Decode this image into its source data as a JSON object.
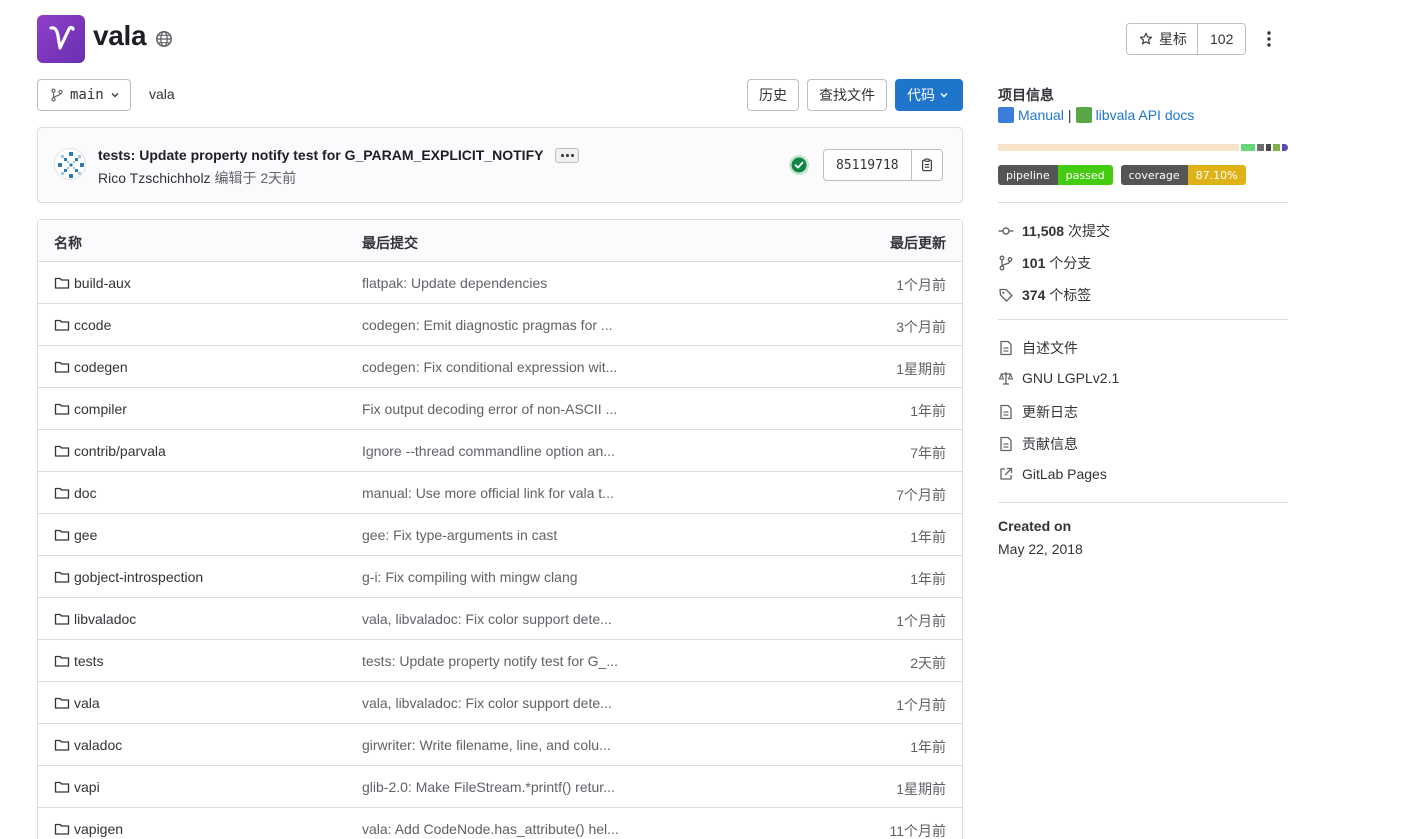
{
  "project": {
    "name": "vala",
    "avatar_letter": "V",
    "avatar_color": "#7b35bd"
  },
  "star": {
    "label": "星标",
    "count": "102"
  },
  "toolbar": {
    "branch": "main",
    "breadcrumb": "vala",
    "history": "历史",
    "find_file": "查找文件",
    "code": "代码",
    "code_color": "#1f75cb"
  },
  "commit": {
    "title": "tests: Update property notify test for G_PARAM_EXPLICIT_NOTIFY",
    "author": "Rico Tzschichholz",
    "meta": "编辑于 2天前",
    "sha": "85119718",
    "status_color": "#108548"
  },
  "table": {
    "headers": {
      "name": "名称",
      "last_commit": "最后提交",
      "last_update": "最后更新"
    },
    "rows": [
      {
        "name": "build-aux",
        "message": "flatpak: Update dependencies",
        "time": "1个月前"
      },
      {
        "name": "ccode",
        "message": "codegen: Emit diagnostic pragmas for ...",
        "time": "3个月前"
      },
      {
        "name": "codegen",
        "message": "codegen: Fix conditional expression wit...",
        "time": "1星期前"
      },
      {
        "name": "compiler",
        "message": "Fix output decoding error of non-ASCII ...",
        "time": "1年前"
      },
      {
        "name": "contrib/parvala",
        "message": "Ignore --thread commandline option an...",
        "time": "7年前"
      },
      {
        "name": "doc",
        "message": "manual: Use more official link for vala t...",
        "time": "7个月前"
      },
      {
        "name": "gee",
        "message": "gee: Fix type-arguments in cast",
        "time": "1年前"
      },
      {
        "name": "gobject-introspection",
        "message": "g-i: Fix compiling with mingw clang",
        "time": "1年前"
      },
      {
        "name": "libvaladoc",
        "message": "vala, libvaladoc: Fix color support dete...",
        "time": "1个月前"
      },
      {
        "name": "tests",
        "message": "tests: Update property notify test for G_...",
        "time": "2天前"
      },
      {
        "name": "vala",
        "message": "vala, libvaladoc: Fix color support dete...",
        "time": "1个月前"
      },
      {
        "name": "valadoc",
        "message": "girwriter: Write filename, line, and colu...",
        "time": "1年前"
      },
      {
        "name": "vapi",
        "message": "glib-2.0: Make FileStream.*printf() retur...",
        "time": "1星期前"
      },
      {
        "name": "vapigen",
        "message": "vala: Add CodeNode.has_attribute() hel...",
        "time": "11个月前"
      }
    ]
  },
  "sidebar": {
    "heading": "项目信息",
    "links": [
      {
        "label": "Manual",
        "icon": "blue-book-icon"
      },
      {
        "label": "libvala API docs",
        "icon": "green-book-icon"
      }
    ],
    "link_separator": "|",
    "language_colors": [
      "#f6e3c9",
      "#66d67a",
      "#6e6e6e",
      "#4a4a4a",
      "#7fb24a",
      "#5b4aa8"
    ],
    "badges": [
      {
        "left": "pipeline",
        "right": "passed",
        "right_color": "#4c1"
      },
      {
        "left": "coverage",
        "right": "87.10%",
        "right_color": "#dfb317"
      }
    ],
    "stats": [
      {
        "value": "11,508",
        "label": "次提交",
        "icon": "commit-icon"
      },
      {
        "value": "101",
        "label": "个分支",
        "icon": "branch-icon"
      },
      {
        "value": "374",
        "label": "个标签",
        "icon": "tag-icon"
      }
    ],
    "files": [
      {
        "label": "自述文件",
        "icon": "document-icon"
      },
      {
        "label": "GNU LGPLv2.1",
        "icon": "scale-icon"
      },
      {
        "label": "更新日志",
        "icon": "document-icon"
      },
      {
        "label": "贡献信息",
        "icon": "document-icon"
      },
      {
        "label": "GitLab Pages",
        "icon": "external-link-icon"
      }
    ],
    "created_label": "Created on",
    "created_date": "May 22, 2018"
  }
}
